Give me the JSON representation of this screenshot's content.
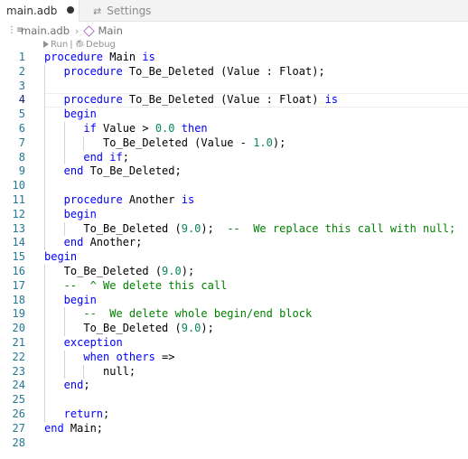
{
  "tabs": [
    {
      "label": "main.adb",
      "active": true,
      "dirty": true
    },
    {
      "label": "Settings",
      "active": false,
      "icon": "settings-sliders-icon"
    }
  ],
  "breadcrumb": {
    "file": "main.adb",
    "symbol": "Main"
  },
  "codelens": {
    "run": "Run",
    "separator": "|",
    "debug": "Debug"
  },
  "colors": {
    "keyword": "#0000ff",
    "number": "#098658",
    "comment": "#008000",
    "line_number": "#237893"
  },
  "lines": [
    {
      "n": "1",
      "tokens": [
        {
          "t": "procedure",
          "c": "kw"
        },
        {
          "t": " Main ",
          "c": "tx"
        },
        {
          "t": "is",
          "c": "kw"
        }
      ]
    },
    {
      "n": "2",
      "tokens": [
        {
          "t": "   procedure",
          "c": "kw"
        },
        {
          "t": " To_Be_Deleted (Value : Float);",
          "c": "tx"
        }
      ]
    },
    {
      "n": "3",
      "tokens": []
    },
    {
      "n": "4",
      "tokens": [
        {
          "t": "   procedure",
          "c": "kw"
        },
        {
          "t": " To_Be_Deleted (Value : Float) ",
          "c": "tx"
        },
        {
          "t": "is",
          "c": "kw"
        }
      ]
    },
    {
      "n": "5",
      "tokens": [
        {
          "t": "   begin",
          "c": "kw"
        }
      ]
    },
    {
      "n": "6",
      "tokens": [
        {
          "t": "      if",
          "c": "kw"
        },
        {
          "t": " Value > ",
          "c": "tx"
        },
        {
          "t": "0.0",
          "c": "num"
        },
        {
          "t": " then",
          "c": "kw"
        }
      ]
    },
    {
      "n": "7",
      "tokens": [
        {
          "t": "         To_Be_Deleted (Value - ",
          "c": "tx"
        },
        {
          "t": "1.0",
          "c": "num"
        },
        {
          "t": ");",
          "c": "tx"
        }
      ]
    },
    {
      "n": "8",
      "tokens": [
        {
          "t": "      end if",
          "c": "kw"
        },
        {
          "t": ";",
          "c": "tx"
        }
      ]
    },
    {
      "n": "9",
      "tokens": [
        {
          "t": "   end",
          "c": "kw"
        },
        {
          "t": " To_Be_Deleted;",
          "c": "tx"
        }
      ]
    },
    {
      "n": "10",
      "tokens": []
    },
    {
      "n": "11",
      "tokens": [
        {
          "t": "   procedure",
          "c": "kw"
        },
        {
          "t": " Another ",
          "c": "tx"
        },
        {
          "t": "is",
          "c": "kw"
        }
      ]
    },
    {
      "n": "12",
      "tokens": [
        {
          "t": "   begin",
          "c": "kw"
        }
      ]
    },
    {
      "n": "13",
      "tokens": [
        {
          "t": "      To_Be_Deleted (",
          "c": "tx"
        },
        {
          "t": "9.0",
          "c": "num"
        },
        {
          "t": ");  ",
          "c": "tx"
        },
        {
          "t": "--  We replace this call with null;",
          "c": "cm"
        }
      ]
    },
    {
      "n": "14",
      "tokens": [
        {
          "t": "   end",
          "c": "kw"
        },
        {
          "t": " Another;",
          "c": "tx"
        }
      ]
    },
    {
      "n": "15",
      "tokens": [
        {
          "t": "begin",
          "c": "kw"
        }
      ]
    },
    {
      "n": "16",
      "tokens": [
        {
          "t": "   To_Be_Deleted (",
          "c": "tx"
        },
        {
          "t": "9.0",
          "c": "num"
        },
        {
          "t": ");",
          "c": "tx"
        }
      ]
    },
    {
      "n": "17",
      "tokens": [
        {
          "t": "   --  ^ We delete this call",
          "c": "cm"
        }
      ]
    },
    {
      "n": "18",
      "tokens": [
        {
          "t": "   begin",
          "c": "kw"
        }
      ]
    },
    {
      "n": "19",
      "tokens": [
        {
          "t": "      --  We delete whole begin/end block",
          "c": "cm"
        }
      ]
    },
    {
      "n": "20",
      "tokens": [
        {
          "t": "      To_Be_Deleted (",
          "c": "tx"
        },
        {
          "t": "9.0",
          "c": "num"
        },
        {
          "t": ");",
          "c": "tx"
        }
      ]
    },
    {
      "n": "21",
      "tokens": [
        {
          "t": "   exception",
          "c": "kw"
        }
      ]
    },
    {
      "n": "22",
      "tokens": [
        {
          "t": "      when others",
          "c": "kw"
        },
        {
          "t": " =>",
          "c": "tx"
        }
      ]
    },
    {
      "n": "23",
      "tokens": [
        {
          "t": "         null;",
          "c": "tx"
        }
      ]
    },
    {
      "n": "24",
      "tokens": [
        {
          "t": "   end",
          "c": "kw"
        },
        {
          "t": ";",
          "c": "tx"
        }
      ]
    },
    {
      "n": "25",
      "tokens": []
    },
    {
      "n": "26",
      "tokens": [
        {
          "t": "   return",
          "c": "kw"
        },
        {
          "t": ";",
          "c": "tx"
        }
      ]
    },
    {
      "n": "27",
      "tokens": [
        {
          "t": "end",
          "c": "kw"
        },
        {
          "t": " Main;",
          "c": "tx"
        }
      ]
    },
    {
      "n": "28",
      "tokens": []
    }
  ],
  "current_line": "4"
}
